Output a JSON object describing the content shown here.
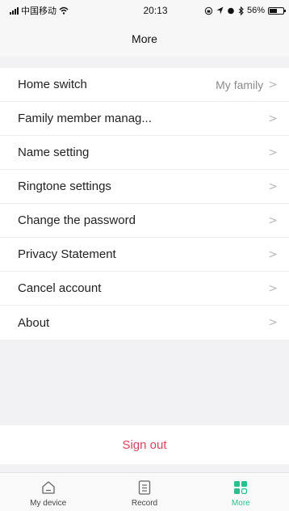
{
  "status_bar": {
    "carrier": "中国移动",
    "time": "20:13",
    "battery_percent": "56%",
    "battery_level": 0.56
  },
  "header": {
    "title": "More"
  },
  "menu": {
    "items": [
      {
        "label": "Home switch",
        "value": "My family"
      },
      {
        "label": "Family member manag...",
        "value": ""
      },
      {
        "label": "Name setting",
        "value": ""
      },
      {
        "label": "Ringtone settings",
        "value": ""
      },
      {
        "label": "Change the password",
        "value": ""
      },
      {
        "label": "Privacy Statement",
        "value": ""
      },
      {
        "label": "Cancel account",
        "value": ""
      },
      {
        "label": "About",
        "value": ""
      }
    ],
    "chevron": ">"
  },
  "sign_out": {
    "label": "Sign out",
    "color": "#d9445c"
  },
  "tab_bar": {
    "tabs": [
      {
        "label": "My device",
        "icon": "home-icon",
        "active": false
      },
      {
        "label": "Record",
        "icon": "record-icon",
        "active": false
      },
      {
        "label": "More",
        "icon": "grid-icon",
        "active": true
      }
    ],
    "active_color": "#2bbf8f"
  }
}
